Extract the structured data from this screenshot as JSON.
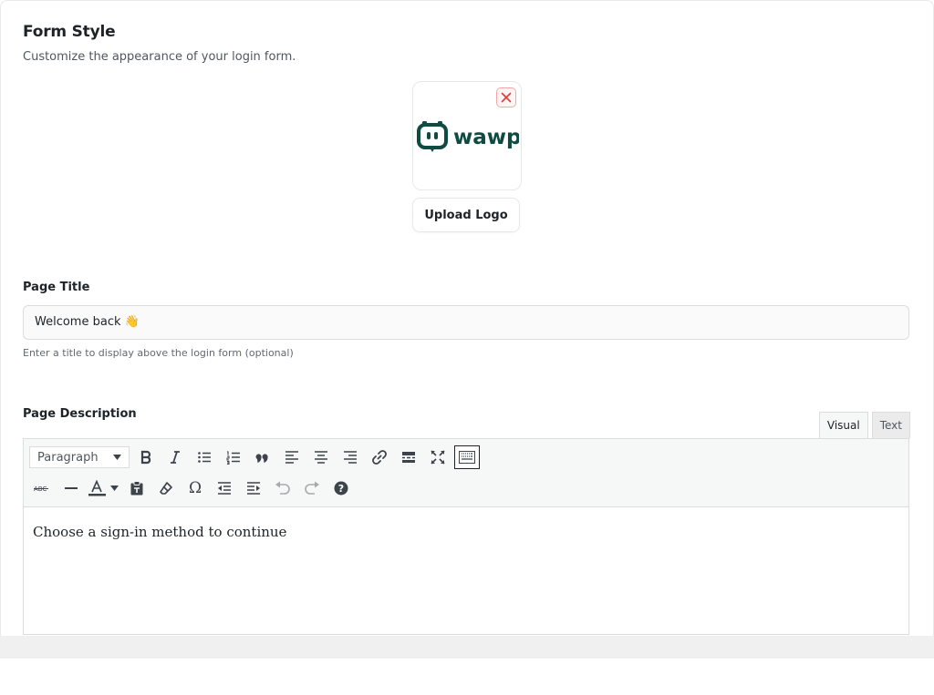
{
  "section": {
    "title": "Form Style",
    "subtitle": "Customize the appearance of your login form."
  },
  "logo": {
    "text": "wawp",
    "upload_label": "Upload Logo",
    "brand_color": "#0f4a43",
    "remove_color": "#e03b3b"
  },
  "page_title": {
    "label": "Page Title",
    "value": "Welcome back 👋",
    "help": "Enter a title to display above the login form (optional)"
  },
  "page_description": {
    "label": "Page Description",
    "tabs": [
      "Visual",
      "Text"
    ],
    "active_tab": "Visual",
    "format_value": "Paragraph",
    "content": "Choose a sign-in method to continue",
    "toolbar_row1": [
      "bold-icon",
      "italic-icon",
      "bullet-list-icon",
      "numbered-list-icon",
      "blockquote-icon",
      "align-left-icon",
      "align-center-icon",
      "align-right-icon",
      "link-icon",
      "read-more-icon",
      "fullscreen-icon",
      "toolbar-toggle-icon"
    ],
    "toolbar_row2": [
      "strikethrough-icon",
      "horizontal-line-icon",
      "text-color-icon",
      "paste-text-icon",
      "clear-formatting-icon",
      "special-character-icon",
      "outdent-icon",
      "indent-icon",
      "undo-icon",
      "redo-icon",
      "help-icon"
    ]
  }
}
